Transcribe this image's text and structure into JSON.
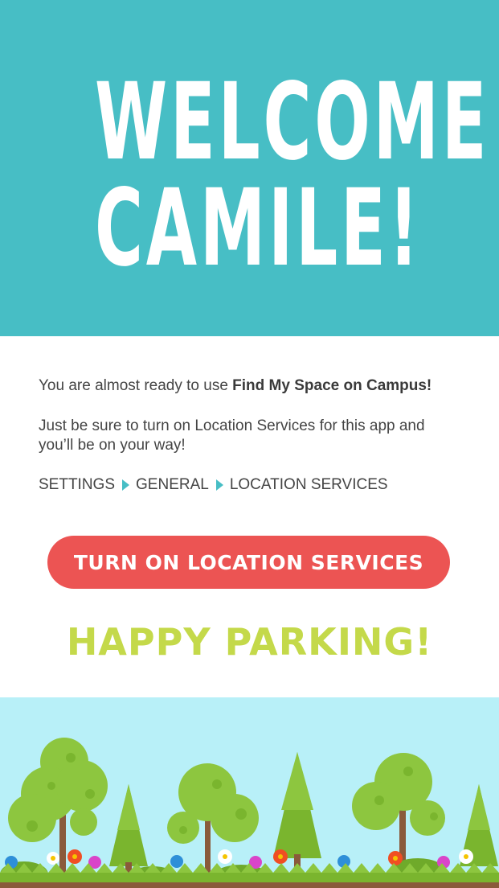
{
  "header": {
    "line1": "WELCOME",
    "line2": "CAMILE!",
    "bg_color": "#47bec5"
  },
  "intro": {
    "text_prefix": "You are almost ready to use ",
    "app_name": "Find My Space on Campus!",
    "instruction": "Just be sure to turn on Location Services for this app and you’ll be on your way!"
  },
  "settings_path": [
    "SETTINGS",
    "GENERAL",
    "LOCATION SERVICES"
  ],
  "cta": {
    "label": "TURN ON LOCATION SERVICES",
    "color": "#ec5453"
  },
  "closing": {
    "text": "HAPPY PARKING!",
    "color": "#c4d94a"
  },
  "illustration": {
    "sky_color": "#b8f0f8",
    "icons": [
      "round-tree-icon",
      "pine-tree-icon",
      "flower-icon",
      "bush-icon",
      "grass-icon"
    ]
  }
}
